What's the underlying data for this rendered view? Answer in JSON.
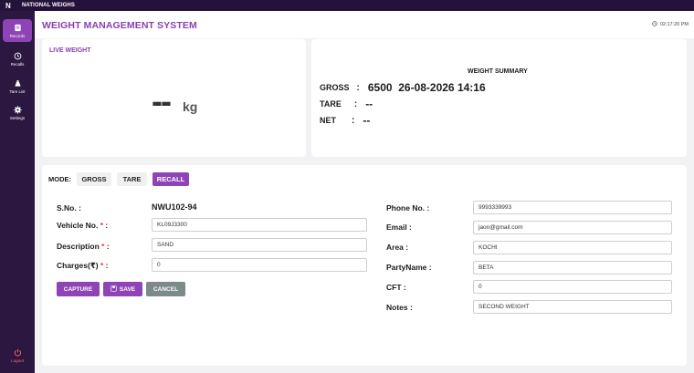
{
  "app": {
    "title": "NATIONAL WEIGHS",
    "logo_text": "N"
  },
  "sidebar": {
    "items": [
      {
        "label": "Records",
        "icon": "records-icon",
        "active": true
      },
      {
        "label": "Recalls",
        "icon": "history-icon",
        "active": false
      },
      {
        "label": "Tare List",
        "icon": "scale-icon",
        "active": false
      },
      {
        "label": "Settings",
        "icon": "gear-icon",
        "active": false
      }
    ],
    "logout_label": "Logout"
  },
  "header": {
    "title": "WEIGHT MANAGEMENT SYSTEM",
    "time": "02:17:20 PM"
  },
  "live": {
    "title": "LIVE WEIGHT",
    "value": "--",
    "unit": "kg"
  },
  "summary": {
    "title": "WEIGHT SUMMARY",
    "gross_label": "GROSS",
    "gross_value": "6500  26-08-2026 14:16",
    "tare_label": "TARE",
    "tare_value": "--",
    "net_label": "NET",
    "net_value": "--",
    "colon": ":"
  },
  "mode": {
    "label": "MODE:",
    "options": [
      "GROSS",
      "TARE",
      "RECALL"
    ],
    "selected": "RECALL"
  },
  "form": {
    "sno_label": "S.No. :",
    "sno_value": "NWU102-94",
    "vehicle_label": "Vehicle No.",
    "vehicle_value": "KL09J3300",
    "description_label": "Description",
    "description_value": "SAND",
    "charges_label": "Charges(₹)",
    "charges_value": "0",
    "phone_label": "Phone No. :",
    "phone_value": "9993339993",
    "email_label": "Email :",
    "email_value": "jaon@gmail.com",
    "area_label": "Area :",
    "area_value": "KOCHI",
    "party_label": "PartyName :",
    "party_value": "BETA",
    "cft_label": "CFT :",
    "cft_value": "0",
    "notes_label": "Notes :",
    "notes_value": "SECOND WEIGHT",
    "required_mark": "*",
    "label_suffix": ":"
  },
  "actions": {
    "capture": "CAPTURE",
    "save": "SAVE",
    "cancel": "CANCEL"
  },
  "colors": {
    "accent": "#8e44b5",
    "sidebar": "#2b1740",
    "titlebar": "#24123a",
    "cancel": "#7d8a8a",
    "required": "#e53935"
  }
}
